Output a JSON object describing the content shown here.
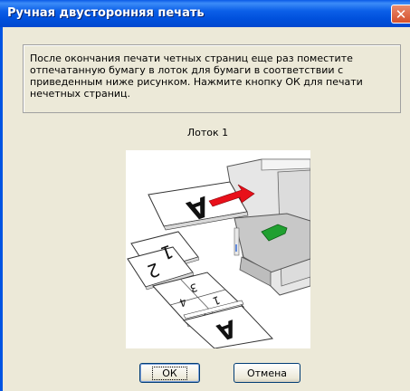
{
  "window": {
    "title": "Ручная двусторонняя печать",
    "close_symbol": "✕"
  },
  "message": {
    "lines": [
      "После окончания печати четных страниц еще раз поместите",
      "отпечатанную бумагу в лоток для бумаги в соответствии с",
      "приведенным ниже рисунком. Нажмите кнопку ОК для печати",
      "нечетных страниц."
    ]
  },
  "tray_label": "Лоток 1",
  "illustration": {
    "glyphs": {
      "sheet_a": "A",
      "sheet_one": "1",
      "sheet_two": "2",
      "grid": [
        "3",
        "4",
        "1",
        "2"
      ]
    },
    "colors": {
      "arrow_red": "#e8101a",
      "arrow_green": "#20a030",
      "tray": "#c8c8c8"
    }
  },
  "buttons": {
    "ok": "ОК",
    "cancel": "Отмена"
  }
}
